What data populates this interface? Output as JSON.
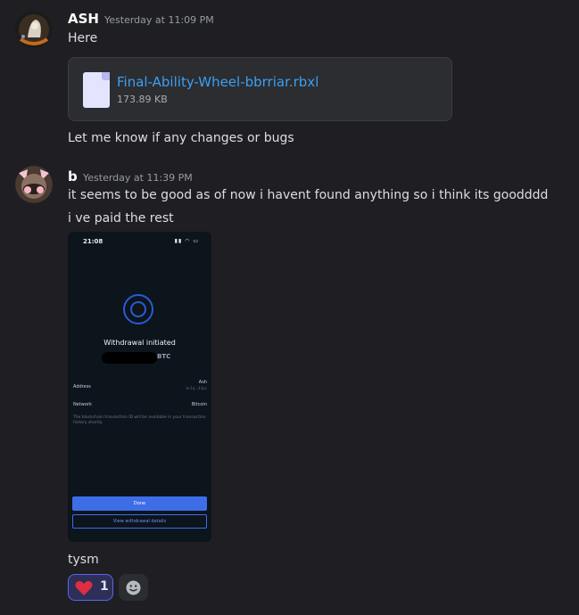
{
  "messages": [
    {
      "author": "ASH",
      "author_color": "#ffffff",
      "timestamp": "Yesterday at 11:09 PM",
      "lines": [
        "Here"
      ],
      "attachment": {
        "file_name": "Final-Ability-Wheel-bbrriar.rbxl",
        "file_size": "173.89 KB",
        "icon": "file-icon"
      },
      "after_lines": [
        "Let me know if any changes or bugs"
      ]
    },
    {
      "author": "b",
      "author_color": "#ffffff",
      "timestamp": "Yesterday at 11:39 PM",
      "lines": [
        "it seems to be good as of now i havent found anything so i think its goodddd",
        "i ve paid the rest"
      ],
      "image": {
        "time": "21:08",
        "title": "Withdrawal initiated",
        "amount_unit": "BTC",
        "address_label": "Address",
        "address_value": "Ash",
        "address_sub": "bc1q...43pc",
        "network_label": "Network",
        "network_value": "Bitcoin",
        "note": "The blockchain transaction ID will be available in your transaction history shortly.",
        "done_button": "Done",
        "details_button": "View withdrawal details"
      },
      "after_lines": [
        "tysm"
      ],
      "reactions": [
        {
          "emoji": "heart",
          "count": "1"
        }
      ]
    }
  ],
  "colors": {
    "background": "#1f1f23",
    "link": "#3e9ff0",
    "accent": "#5865f2"
  }
}
